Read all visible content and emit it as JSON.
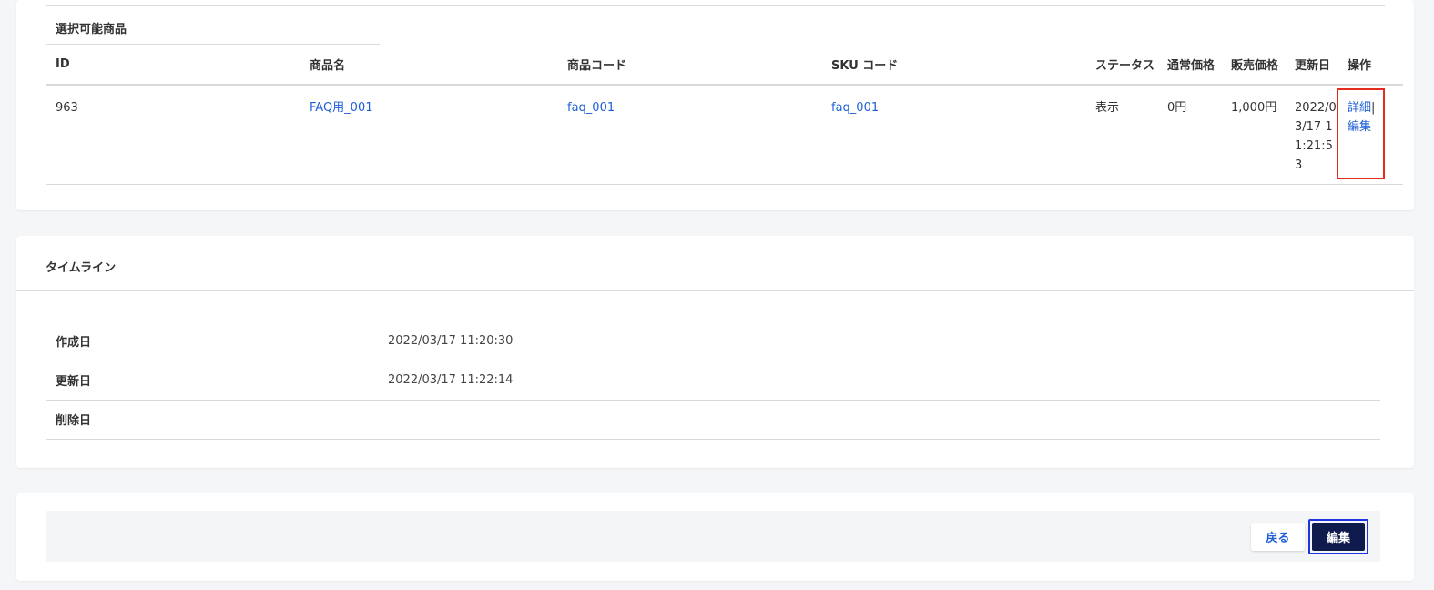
{
  "products_section": {
    "tab_label": "選択可能商品",
    "columns": [
      "ID",
      "商品名",
      "商品コード",
      "SKU コード",
      "ステータス",
      "通常価格",
      "販売価格",
      "更新日",
      "操作"
    ],
    "rows": [
      {
        "id": "963",
        "name": "FAQ用_001",
        "code": "faq_001",
        "sku": "faq_001",
        "status": "表示",
        "regular_price": "0円",
        "sale_price": "1,000円",
        "updated": "2022/03/17 11:21:53",
        "detail_label": "詳細",
        "separator": "|",
        "edit_label": "編集"
      }
    ]
  },
  "timeline": {
    "title": "タイムライン",
    "rows": [
      {
        "label": "作成日",
        "value": "2022/03/17 11:20:30"
      },
      {
        "label": "更新日",
        "value": "2022/03/17 11:22:14"
      },
      {
        "label": "削除日",
        "value": ""
      }
    ]
  },
  "actions": {
    "back_label": "戻る",
    "edit_label": "編集"
  },
  "colors": {
    "link": "#1f5fd6",
    "primary_button": "#0f1b4c",
    "highlight_red": "#e42b1c",
    "highlight_blue": "#1c35e0"
  }
}
